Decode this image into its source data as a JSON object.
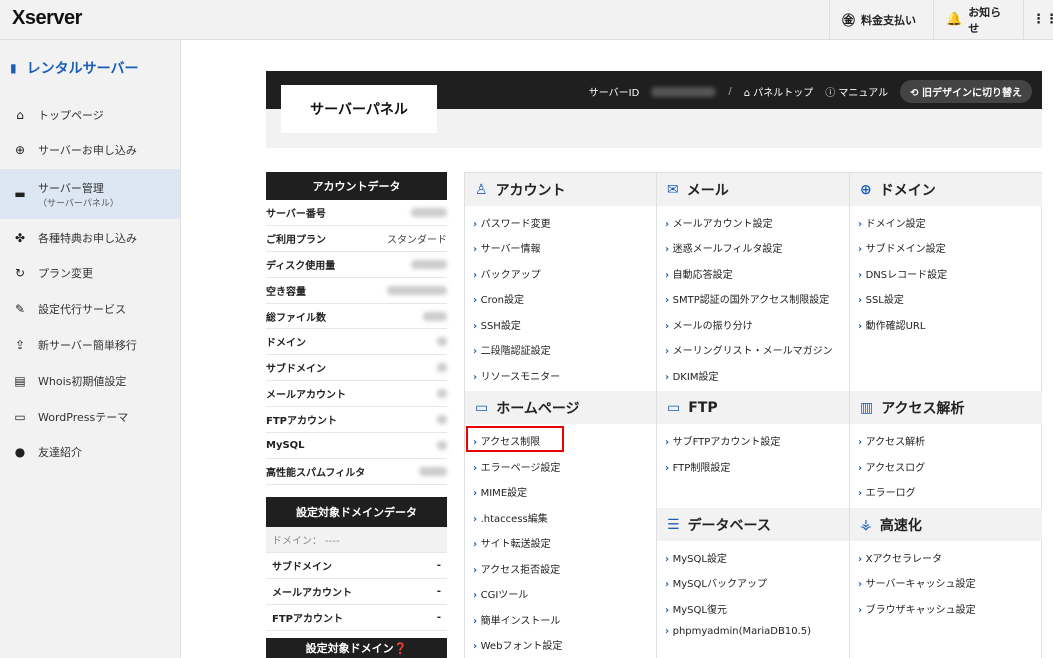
{
  "app": {
    "logo": "Xserver"
  },
  "topbar": {
    "billing": "料金支払い",
    "notice": "お知らせ"
  },
  "sidebar": {
    "header": "レンタルサーバー",
    "items": [
      {
        "label": "トップページ",
        "icon": "home-icon"
      },
      {
        "label": "サーバーお申し込み",
        "icon": "plus-icon"
      },
      {
        "label": "サーバー管理",
        "sub": "（サーバーパネル）",
        "icon": "server-icon"
      },
      {
        "label": "各種特典お申し込み",
        "icon": "gift-icon"
      },
      {
        "label": "プラン変更",
        "icon": "refresh-icon"
      },
      {
        "label": "設定代行サービス",
        "icon": "wrench-icon"
      },
      {
        "label": "新サーバー簡単移行",
        "icon": "upload-icon"
      },
      {
        "label": "Whois初期値設定",
        "icon": "document-icon"
      },
      {
        "label": "WordPressテーマ",
        "icon": "window-icon"
      },
      {
        "label": "友達紹介",
        "icon": "user-icon"
      }
    ]
  },
  "panel": {
    "title": "サーバーパネル",
    "server_id_label": "サーバーID",
    "sep": "/",
    "panel_top": "パネルトップ",
    "manual": "マニュアル",
    "old_design": "旧デザインに切り替え"
  },
  "account": {
    "header": "アカウントデータ",
    "rows": [
      {
        "label": "サーバー番号",
        "value": ""
      },
      {
        "label": "ご利用プラン",
        "value": "スタンダード"
      },
      {
        "label": "ディスク使用量",
        "value": ""
      },
      {
        "label": "空き容量",
        "value": ""
      },
      {
        "label": "総ファイル数",
        "value": ""
      },
      {
        "label": "ドメイン",
        "value": ""
      },
      {
        "label": "サブドメイン",
        "value": ""
      },
      {
        "label": "メールアカウント",
        "value": ""
      },
      {
        "label": "FTPアカウント",
        "value": ""
      },
      {
        "label": "MySQL",
        "value": ""
      },
      {
        "label": "高性能スパムフィルタ",
        "value": ""
      }
    ]
  },
  "domain_data": {
    "header": "設定対象ドメインデータ",
    "domain_row": "ドメイン： ----",
    "rows": [
      {
        "label": "サブドメイン",
        "value": "-"
      },
      {
        "label": "メールアカウント",
        "value": "-"
      },
      {
        "label": "FTPアカウント",
        "value": "-"
      }
    ],
    "footer_header": "設定対象ドメイン"
  },
  "sections": {
    "account": {
      "title": "アカウント",
      "links": [
        "パスワード変更",
        "サーバー情報",
        "バックアップ",
        "Cron設定",
        "SSH設定",
        "二段階認証設定",
        "リソースモニター"
      ]
    },
    "mail": {
      "title": "メール",
      "links": [
        "メールアカウント設定",
        "迷惑メールフィルタ設定",
        "自動応答設定",
        "SMTP認証の国外アクセス制限設定",
        "メールの振り分け",
        "メーリングリスト・メールマガジン",
        "DKIM設定"
      ]
    },
    "domain": {
      "title": "ドメイン",
      "links": [
        "ドメイン設定",
        "サブドメイン設定",
        "DNSレコード設定",
        "SSL設定",
        "動作確認URL"
      ]
    },
    "homepage": {
      "title": "ホームページ",
      "links": [
        "アクセス制限",
        "エラーページ設定",
        "MIME設定",
        ".htaccess編集",
        "サイト転送設定",
        "アクセス拒否設定",
        "CGIツール",
        "簡単インストール",
        "Webフォント設定"
      ]
    },
    "ftp": {
      "title": "FTP",
      "links": [
        "サブFTPアカウント設定",
        "FTP制限設定"
      ]
    },
    "analytics": {
      "title": "アクセス解析",
      "links": [
        "アクセス解析",
        "アクセスログ",
        "エラーログ"
      ]
    },
    "database": {
      "title": "データベース",
      "links": [
        "MySQL設定",
        "MySQLバックアップ",
        "MySQL復元",
        "phpmyadmin(MariaDB10.5)"
      ]
    },
    "speed": {
      "title": "高速化",
      "links": [
        "Xアクセラレータ",
        "サーバーキャッシュ設定",
        "ブラウザキャッシュ設定"
      ]
    }
  }
}
